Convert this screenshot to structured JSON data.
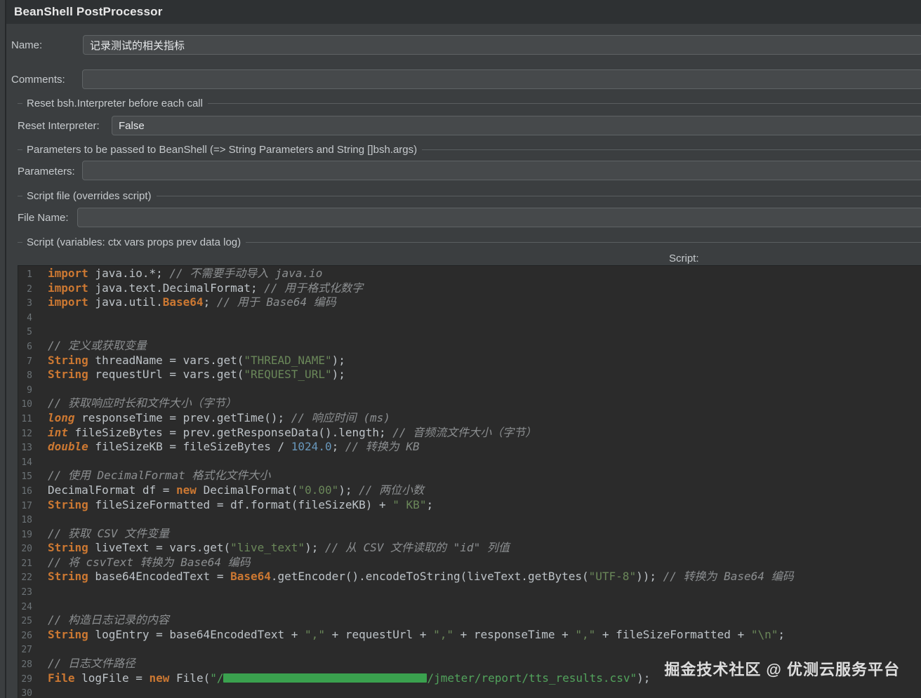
{
  "header": {
    "title": "BeanShell PostProcessor"
  },
  "fields": {
    "name_label": "Name:",
    "name_value": "记录测试的相关指标",
    "comments_label": "Comments:",
    "comments_value": "",
    "reset_group_title": "Reset bsh.Interpreter before each call",
    "reset_label": "Reset Interpreter:",
    "reset_value": "False",
    "params_group_title": "Parameters to be passed to BeanShell (=> String Parameters and String []bsh.args)",
    "params_label": "Parameters:",
    "params_value": "",
    "script_file_group_title": "Script file (overrides script)",
    "file_name_label": "File Name:",
    "file_name_value": "",
    "script_group_title": "Script (variables: ctx vars props prev data log)",
    "script_label": "Script:"
  },
  "watermark": "掘金技术社区 @ 优测云服务平台",
  "editor": {
    "token_colors": {
      "p": "#bdc3c8",
      "kw": "#cc7832",
      "type": "#cc7832",
      "cls": "#cc7832",
      "str": "#6a8759",
      "strb": "#52a35c",
      "com": "#8c8f91",
      "num": "#6897bb",
      "red": "#3aa14e"
    },
    "lines": [
      [
        [
          "kw",
          "import"
        ],
        [
          "p",
          " java.io.*; "
        ],
        [
          "com",
          "// 不需要手动导入 java.io"
        ]
      ],
      [
        [
          "kw",
          "import"
        ],
        [
          "p",
          " java.text.DecimalFormat; "
        ],
        [
          "com",
          "// 用于格式化数字"
        ]
      ],
      [
        [
          "kw",
          "import"
        ],
        [
          "p",
          " java.util."
        ],
        [
          "cls",
          "Base64"
        ],
        [
          "p",
          "; "
        ],
        [
          "com",
          "// 用于 Base64 编码"
        ]
      ],
      [],
      [],
      [
        [
          "com",
          "// 定义或获取变量"
        ]
      ],
      [
        [
          "kw",
          "String"
        ],
        [
          "p",
          " threadName = vars.get("
        ],
        [
          "str",
          "\"THREAD_NAME\""
        ],
        [
          "p",
          ");"
        ]
      ],
      [
        [
          "kw",
          "String"
        ],
        [
          "p",
          " requestUrl = vars.get("
        ],
        [
          "str",
          "\"REQUEST_URL\""
        ],
        [
          "p",
          ");"
        ]
      ],
      [],
      [
        [
          "com",
          "// 获取响应时长和文件大小（字节）"
        ]
      ],
      [
        [
          "type",
          "long"
        ],
        [
          "p",
          " responseTime = prev.getTime(); "
        ],
        [
          "com",
          "// 响应时间 (ms)"
        ]
      ],
      [
        [
          "type",
          "int"
        ],
        [
          "p",
          " fileSizeBytes = prev.getResponseData().length; "
        ],
        [
          "com",
          "// 音频流文件大小（字节）"
        ]
      ],
      [
        [
          "type",
          "double"
        ],
        [
          "p",
          " fileSizeKB = fileSizeBytes / "
        ],
        [
          "num",
          "1024.0"
        ],
        [
          "p",
          "; "
        ],
        [
          "com",
          "// 转换为 KB"
        ]
      ],
      [],
      [
        [
          "com",
          "// 使用 DecimalFormat 格式化文件大小"
        ]
      ],
      [
        [
          "p",
          "DecimalFormat df = "
        ],
        [
          "kw",
          "new"
        ],
        [
          "p",
          " DecimalFormat("
        ],
        [
          "str",
          "\"0.00\""
        ],
        [
          "p",
          "); "
        ],
        [
          "com",
          "// 两位小数"
        ]
      ],
      [
        [
          "kw",
          "String"
        ],
        [
          "p",
          " fileSizeFormatted = df.format(fileSizeKB) + "
        ],
        [
          "str",
          "\" KB\""
        ],
        [
          "p",
          ";"
        ]
      ],
      [],
      [
        [
          "com",
          "// 获取 CSV 文件变量"
        ]
      ],
      [
        [
          "kw",
          "String"
        ],
        [
          "p",
          " liveText = vars.get("
        ],
        [
          "str",
          "\"live_text\""
        ],
        [
          "p",
          "); "
        ],
        [
          "com",
          "// 从 CSV 文件读取的 \"id\" 列值"
        ]
      ],
      [
        [
          "com",
          "// 将 csvText 转换为 Base64 编码"
        ]
      ],
      [
        [
          "kw",
          "String"
        ],
        [
          "p",
          " base64EncodedText = "
        ],
        [
          "cls",
          "Base64"
        ],
        [
          "p",
          ".getEncoder().encodeToString(liveText.getBytes("
        ],
        [
          "str",
          "\"UTF-8\""
        ],
        [
          "p",
          ")); "
        ],
        [
          "com",
          "// 转换为 Base64 编码"
        ]
      ],
      [],
      [],
      [
        [
          "com",
          "// 构造日志记录的内容"
        ]
      ],
      [
        [
          "kw",
          "String"
        ],
        [
          "p",
          " logEntry = base64EncodedText + "
        ],
        [
          "str",
          "\",\""
        ],
        [
          "p",
          " + requestUrl + "
        ],
        [
          "str",
          "\",\""
        ],
        [
          "p",
          " + responseTime + "
        ],
        [
          "str",
          "\",\""
        ],
        [
          "p",
          " + fileSizeFormatted + "
        ],
        [
          "str",
          "\"\\n\""
        ],
        [
          "p",
          ";"
        ]
      ],
      [],
      [
        [
          "com",
          "// 日志文件路径"
        ]
      ],
      [
        [
          "kw",
          "File"
        ],
        [
          "p",
          " logFile = "
        ],
        [
          "kw",
          "new"
        ],
        [
          "p",
          " File("
        ],
        [
          "strb",
          "\"/"
        ],
        [
          "red",
          ""
        ],
        [
          "strb",
          "/jmeter/report/tts_results.csv\""
        ],
        [
          "p",
          ");"
        ]
      ],
      []
    ]
  }
}
